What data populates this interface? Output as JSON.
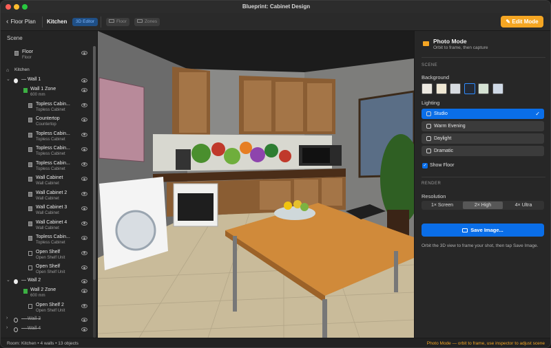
{
  "window": {
    "title": "Blueprint: Cabinet Design"
  },
  "toolbar": {
    "back_label": "Floor Plan",
    "breadcrumb": "Kitchen",
    "view_badge": "3D Editor",
    "floor_btn": "Floor",
    "zones_btn": "Zones",
    "edit_mode_label": "Edit Mode"
  },
  "sidebar": {
    "header": "Scene",
    "floor": {
      "label": "Floor",
      "sub": "Floor"
    },
    "room_label": "Kitchen",
    "wall1": {
      "label": "Wall 1"
    },
    "wall1_items": [
      {
        "label": "Wall 1 Zone",
        "sub": "600 mm",
        "kind": "zone"
      },
      {
        "label": "Topless Cabin...",
        "sub": "Topless Cabinet",
        "kind": "cabinet"
      },
      {
        "label": "Countertop",
        "sub": "Countertop",
        "kind": "cabinet"
      },
      {
        "label": "Topless Cabin...",
        "sub": "Topless Cabinet",
        "kind": "cabinet"
      },
      {
        "label": "Topless Cabin...",
        "sub": "Topless Cabinet",
        "kind": "cabinet"
      },
      {
        "label": "Topless Cabin...",
        "sub": "Topless Cabinet",
        "kind": "cabinet"
      },
      {
        "label": "Wall Cabinet",
        "sub": "Wall Cabinet",
        "kind": "cabinet"
      },
      {
        "label": "Wall Cabinet 2",
        "sub": "Wall Cabinet",
        "kind": "cabinet"
      },
      {
        "label": "Wall Cabinet 3",
        "sub": "Wall Cabinet",
        "kind": "cabinet"
      },
      {
        "label": "Wall Cabinet 4",
        "sub": "Wall Cabinet",
        "kind": "cabinet"
      },
      {
        "label": "Topless Cabin...",
        "sub": "Topless Cabinet",
        "kind": "cabinet"
      },
      {
        "label": "Open Shelf",
        "sub": "Open Shelf Unit",
        "kind": "shelf"
      },
      {
        "label": "Open Shelf",
        "sub": "Open Shelf Unit",
        "kind": "shelf"
      }
    ],
    "wall2": {
      "label": "Wall 2"
    },
    "wall2_items": [
      {
        "label": "Wall 2 Zone",
        "sub": "600 mm",
        "kind": "zone"
      },
      {
        "label": "Open Shelf 2",
        "sub": "Open Shelf Unit",
        "kind": "shelf"
      }
    ],
    "wall3": {
      "label": "Wall 3"
    },
    "wall4": {
      "label": "Wall 4"
    }
  },
  "inspector": {
    "title": "Photo Mode",
    "subtitle": "Orbit to frame, then capture",
    "scene_section": "SCENE",
    "background_label": "Background",
    "background_swatches": [
      "#ece9e1",
      "#efe7d3",
      "#d7dbe0",
      "#232a36",
      "#d5e2d3",
      "#cfd9e6"
    ],
    "selected_swatch": 3,
    "lighting_label": "Lighting",
    "lighting_options": [
      "Studio",
      "Warm Evening",
      "Daylight",
      "Dramatic"
    ],
    "selected_lighting": 0,
    "show_floor_label": "Show Floor",
    "show_floor_checked": true,
    "render_section": "RENDER",
    "resolution_label": "Resolution",
    "resolution_options": [
      "1× Screen",
      "2× High",
      "4× Ultra"
    ],
    "selected_resolution": 1,
    "save_button": "Save Image...",
    "help_text": "Orbit the 3D view to frame your shot, then tap Save Image."
  },
  "status": {
    "left": "Room: Kitchen • 4 walls • 13 objects",
    "right": "Photo Mode — orbit to frame, use inspector to adjust scene"
  },
  "colors": {
    "accent_blue": "#0a6ee8",
    "accent_orange": "#f5a623",
    "zone_green": "#3cb043"
  }
}
